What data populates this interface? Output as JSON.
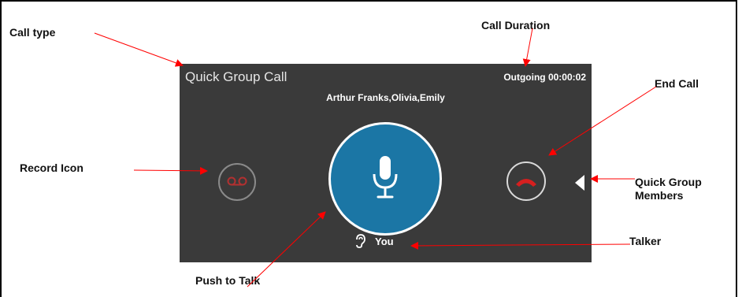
{
  "callouts": {
    "call_type": "Call type",
    "call_duration": "Call Duration",
    "end_call": "End Call",
    "record_icon": "Record Icon",
    "quick_group_members_line1": "Quick Group",
    "quick_group_members_line2": "Members",
    "talker": "Talker",
    "push_to_talk": "Push to Talk"
  },
  "call_screen": {
    "call_type": "Quick Group Call",
    "duration": "Outgoing 00:00:02",
    "participants": "Arthur Franks,Olivia,Emily",
    "talker": "You"
  },
  "icons": {
    "record": "voicemail-icon",
    "push_to_talk": "microphone-icon",
    "end_call": "hang-up-icon",
    "members": "caret-left-icon",
    "talker": "ear-icon"
  },
  "colors": {
    "panel_bg": "#3a3a3a",
    "ptt_blue": "#1b76a5",
    "end_call_red": "#d61f1f",
    "record_red": "#b23030",
    "arrow_red": "#ff0000"
  }
}
